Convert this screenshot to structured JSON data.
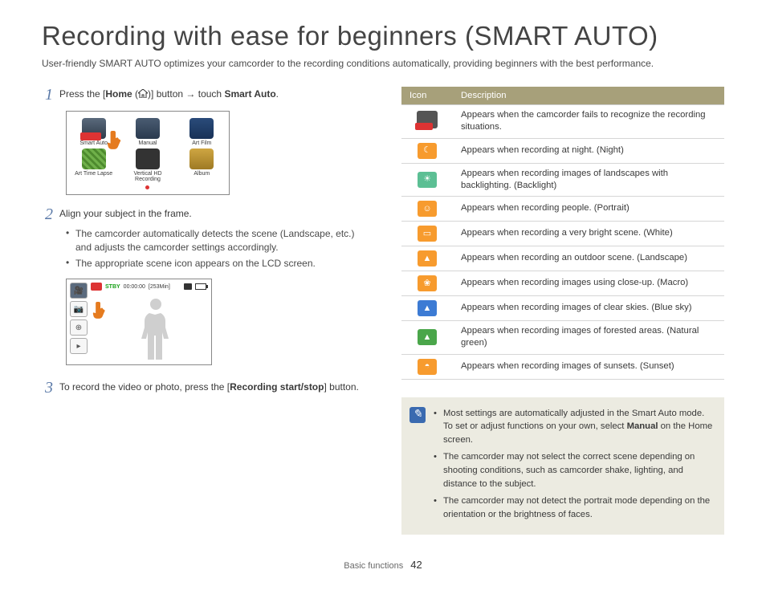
{
  "title": "Recording with ease for beginners (SMART AUTO)",
  "intro": "User-friendly SMART AUTO optimizes your camcorder to the recording conditions automatically, providing beginners with the best performance.",
  "steps": {
    "s1_a": "Press the [",
    "s1_b": "Home",
    "s1_c": " (",
    "s1_d": ")] button → touch ",
    "s1_e": "Smart Auto",
    "s1_f": ".",
    "s2": "Align your subject in the frame.",
    "s2b1": "The camcorder automatically detects the scene (Landscape, etc.) and adjusts the camcorder settings accordingly.",
    "s2b2": "The appropriate scene icon appears on the LCD screen.",
    "s3_a": "To record the video or photo, press the [",
    "s3_b": "Recording start/stop",
    "s3_c": "] button."
  },
  "homeMenu": {
    "items": [
      {
        "label": "Smart Auto",
        "iconClass": "ic-smart"
      },
      {
        "label": "Manual",
        "iconClass": "ic-manual"
      },
      {
        "label": "Art Film",
        "iconClass": "ic-artfilm"
      },
      {
        "label": "Art Time Lapse",
        "iconClass": "ic-lapse"
      },
      {
        "label": "Vertical HD Recording",
        "iconClass": "ic-vert",
        "dot": true
      },
      {
        "label": "Album",
        "iconClass": "ic-album"
      }
    ]
  },
  "lcd": {
    "stby": "STBY",
    "time": "00:00:00",
    "remain": "[253Min]"
  },
  "table": {
    "head_icon": "Icon",
    "head_desc": "Description",
    "rows": [
      {
        "iconClass": "i-smart",
        "glyph": "",
        "desc": "Appears when the camcorder fails to recognize the recording situations."
      },
      {
        "iconClass": "i-orange",
        "glyph": "☾",
        "desc": "Appears when recording at night. (Night)"
      },
      {
        "iconClass": "i-teal",
        "glyph": "☀",
        "desc": "Appears when recording images of landscapes with backlighting. (Backlight)"
      },
      {
        "iconClass": "i-orange",
        "glyph": "☺",
        "desc": "Appears when recording people. (Portrait)"
      },
      {
        "iconClass": "i-orange",
        "glyph": "▭",
        "desc": "Appears when recording a very bright scene. (White)"
      },
      {
        "iconClass": "i-orange",
        "glyph": "▲",
        "desc": "Appears when recording an outdoor scene. (Landscape)"
      },
      {
        "iconClass": "i-orange",
        "glyph": "❀",
        "desc": "Appears when recording images using close-up. (Macro)"
      },
      {
        "iconClass": "i-blue",
        "glyph": "▲",
        "desc": "Appears when recording images of clear skies. (Blue sky)"
      },
      {
        "iconClass": "i-green",
        "glyph": "▲",
        "desc": "Appears when recording images of forested areas. (Natural green)"
      },
      {
        "iconClass": "i-orange",
        "glyph": "◓",
        "desc": "Appears when recording images of sunsets. (Sunset)"
      }
    ]
  },
  "note": {
    "n1_a": "Most settings are automatically adjusted in the Smart Auto mode. To set or adjust functions on your own, select ",
    "n1_b": "Manual",
    "n1_c": " on the Home screen.",
    "n2": "The camcorder may not select the correct scene depending on shooting conditions, such as camcorder shake, lighting, and distance to the subject.",
    "n3": "The camcorder may not detect the portrait mode depending on the orientation or the brightness of faces."
  },
  "footer": {
    "section": "Basic functions",
    "page": "42"
  }
}
